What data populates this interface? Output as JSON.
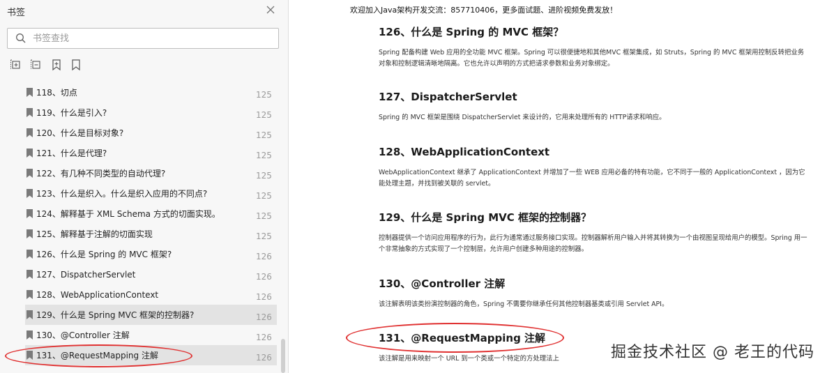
{
  "sidebar": {
    "title": "书签",
    "search_placeholder": "书签查找",
    "items": [
      {
        "label": "118、切点",
        "page": "125"
      },
      {
        "label": "119、什么是引入?",
        "page": "125"
      },
      {
        "label": "120、什么是目标对象?",
        "page": "125"
      },
      {
        "label": "121、什么是代理?",
        "page": "125"
      },
      {
        "label": "122、有几种不同类型的自动代理?",
        "page": "125"
      },
      {
        "label": "123、什么是织入。什么是织入应用的不同点?",
        "page": "125"
      },
      {
        "label": "124、解释基于 XML Schema 方式的切面实现。",
        "page": "125"
      },
      {
        "label": "125、解释基于注解的切面实现",
        "page": "125"
      },
      {
        "label": "126、什么是 Spring 的 MVC 框架?",
        "page": "126"
      },
      {
        "label": "127、DispatcherServlet",
        "page": "126"
      },
      {
        "label": "128、WebApplicationContext",
        "page": "126"
      },
      {
        "label": "129、什么是 Spring MVC 框架的控制器?",
        "page": "126"
      },
      {
        "label": "130、@Controller 注解",
        "page": "126"
      },
      {
        "label": "131、@RequestMapping 注解",
        "page": "126"
      }
    ],
    "selected_index": 11,
    "highlighted_index": 13
  },
  "document": {
    "banner": "欢迎加入Java架构开发交流：857710406，更多面试题、进阶视频免费发放！",
    "sections": [
      {
        "title": "126、什么是 Spring 的 MVC 框架？",
        "body": "Spring 配备构建 Web 应用的全功能 MVC 框架。Spring 可以很便捷地和其他MVC 框架集成，如 Struts，Spring 的 MVC 框架用控制反转把业务对象和控制逻辑清晰地隔离。它也允许以声明的方式把请求参数和业务对象绑定。"
      },
      {
        "title": "127、DispatcherServlet",
        "body": "Spring 的 MVC 框架是围绕 DispatcherServlet 来设计的，它用来处理所有的 HTTP请求和响应。"
      },
      {
        "title": "128、WebApplicationContext",
        "body": "WebApplicationContext 继承了 ApplicationContext 并增加了一些 WEB 应用必备的特有功能，它不同于一般的 ApplicationContext ，因为它能处理主题，并找到被关联的 servlet。"
      },
      {
        "title": "129、什么是 Spring MVC 框架的控制器？",
        "body": "控制器提供一个访问应用程序的行为，此行为通常通过服务接口实现。控制器解析用户输入并将其转换为一个由视图呈现给用户的模型。Spring 用一个非常抽象的方式实现了一个控制层，允许用户创建多种用途的控制器。"
      },
      {
        "title": "130、@Controller 注解",
        "body": "该注解表明该类扮演控制器的角色，Spring 不需要你继承任何其他控制器基类或引用 Servlet API。"
      },
      {
        "title": "131、@RequestMapping 注解",
        "body": "该注解是用来映射一个 URL 到一个类或一个特定的方处理法上"
      }
    ]
  },
  "watermark": "掘金技术社区 @ 老王的代码",
  "colors": {
    "annotation": "#e03030",
    "sidebar_bg": "#f7f7f7",
    "selected_bg": "#e3e3e3"
  }
}
